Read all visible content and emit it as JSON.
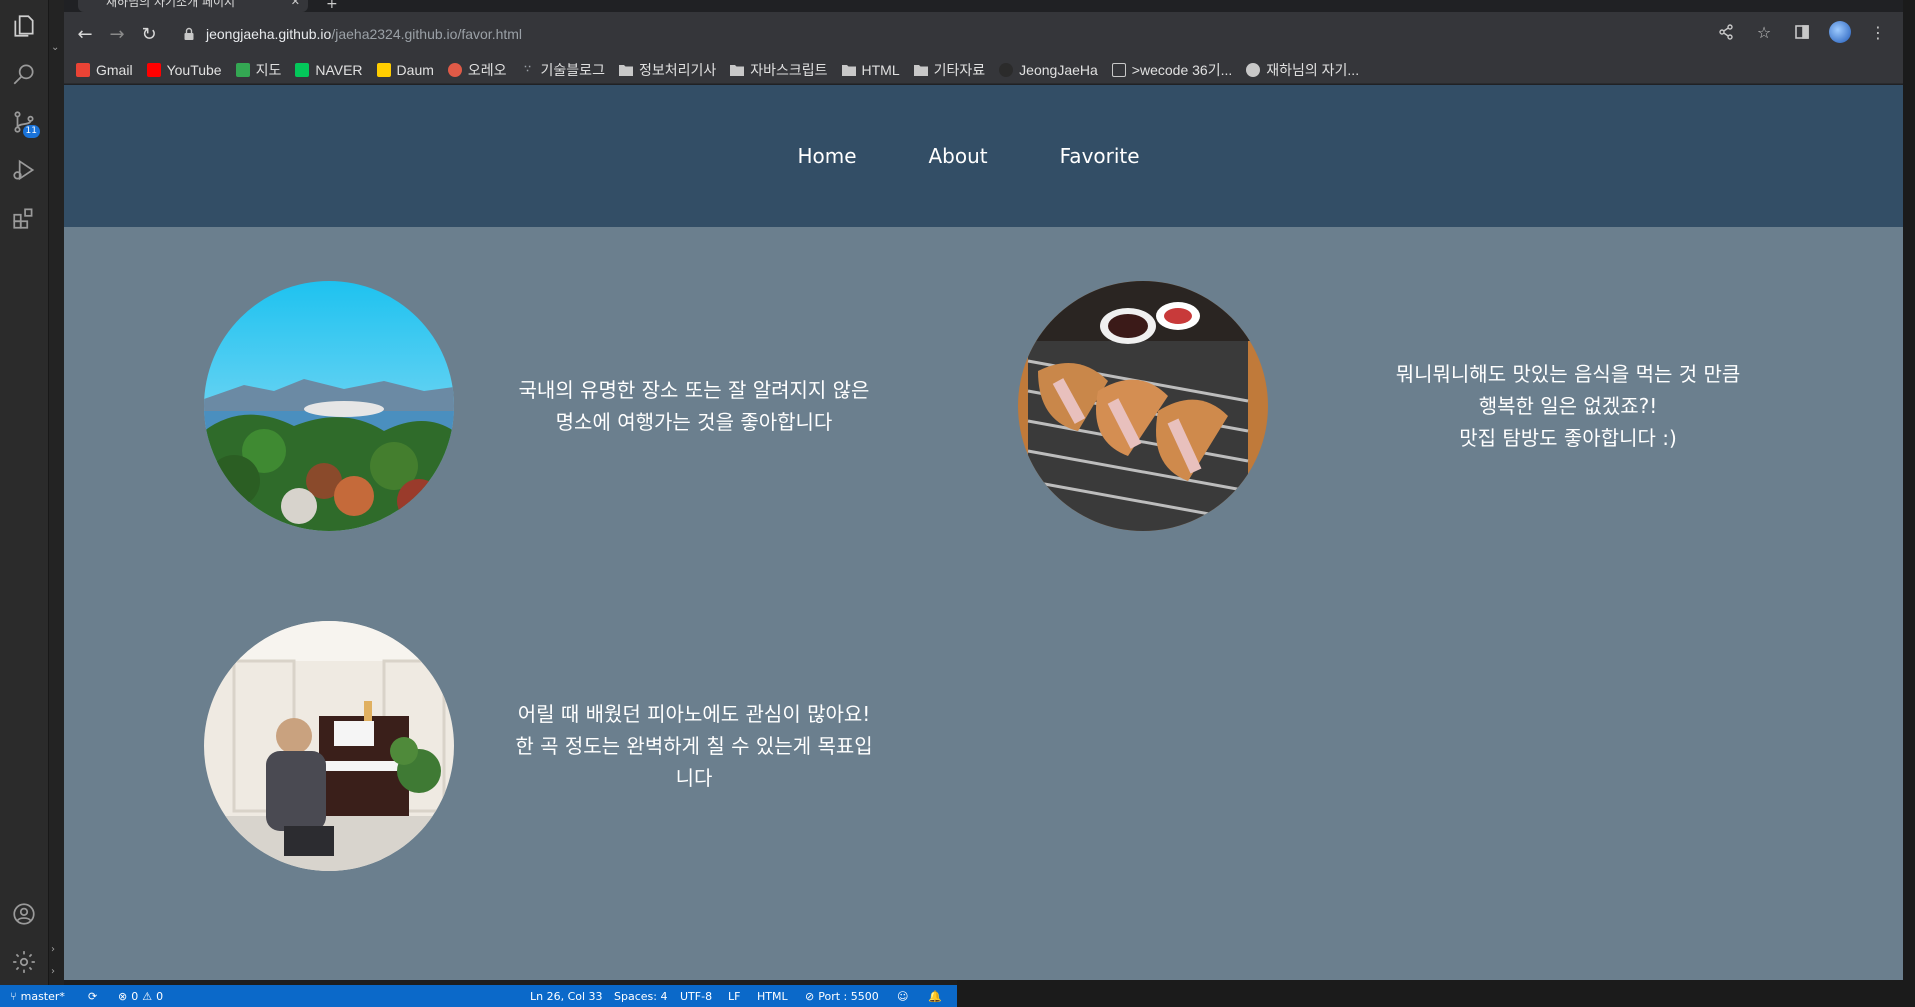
{
  "vscode": {
    "source_control_badge": "11",
    "status": {
      "branch": "master*",
      "errors": "0",
      "warnings": "0",
      "cursor": "Ln 26, Col 33",
      "spaces": "Spaces: 4",
      "encoding": "UTF-8",
      "eol": "LF",
      "language": "HTML",
      "port": "Port : 5500"
    }
  },
  "browser": {
    "tab_title": "재하님의 자기소개 페이지",
    "url_host": "jeongjaeha.github.io",
    "url_path": "/jaeha2324.github.io/favor.html",
    "bookmarks": [
      {
        "label": "Gmail",
        "icon": "gmail-icon",
        "color": "#ea4335"
      },
      {
        "label": "YouTube",
        "icon": "youtube-icon",
        "color": "#ff0000"
      },
      {
        "label": "지도",
        "icon": "maps-icon",
        "color": "#34a853"
      },
      {
        "label": "NAVER",
        "icon": "naver-icon",
        "color": "#03c75a"
      },
      {
        "label": "Daum",
        "icon": "daum-icon",
        "color": "#ffcd00"
      },
      {
        "label": "오레오",
        "icon": "oreo-icon",
        "color": "#e05a47"
      },
      {
        "label": "기술블로그",
        "icon": "blog-icon",
        "color": "#9aa0a6"
      },
      {
        "label": "정보처리기사",
        "icon": "folder-icon",
        "color": "#c8c8c8"
      },
      {
        "label": "자바스크립트",
        "icon": "folder-icon",
        "color": "#c8c8c8"
      },
      {
        "label": "HTML",
        "icon": "folder-icon",
        "color": "#c8c8c8"
      },
      {
        "label": "기타자료",
        "icon": "folder-icon",
        "color": "#c8c8c8"
      },
      {
        "label": "JeongJaeHa",
        "icon": "github-icon",
        "color": "#2b2b2b"
      },
      {
        "label": ">wecode 36기...",
        "icon": "page-icon",
        "color": "#c8c8c8"
      },
      {
        "label": "재하님의 자기...",
        "icon": "globe-icon",
        "color": "#c8c8c8"
      }
    ]
  },
  "site": {
    "nav": [
      "Home",
      "About",
      "Favorite"
    ],
    "favors": [
      {
        "image": "travel-landscape",
        "lines": [
          "국내의 유명한 장소 또는 잘 알려지지 않은",
          "명소에 여행가는 것을 좋아합니다"
        ]
      },
      {
        "image": "tonkatsu-food",
        "lines": [
          "뭐니뭐니해도 맛있는 음식을 먹는 것 만큼",
          "행복한 일은 없겠죠?!",
          "맛집 탐방도 좋아합니다 :)"
        ]
      },
      {
        "image": "piano-player",
        "lines": [
          "어릴 때 배웠던 피아노에도 관심이 많아요!",
          "한 곡 정도는 완벽하게 칠 수 있는게 목표입",
          "니다"
        ]
      }
    ]
  },
  "colors": {
    "header": "#334e66",
    "page_bg": "#6b7f8e",
    "status_bar": "#0b69c9"
  }
}
